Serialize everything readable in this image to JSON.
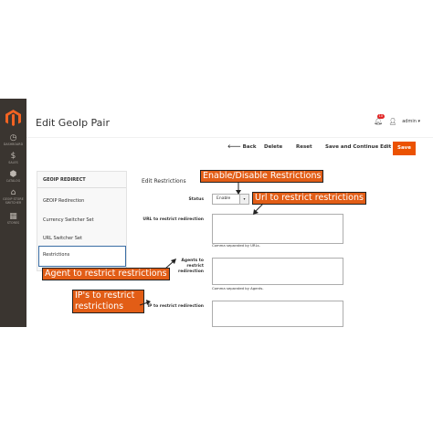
{
  "sidebar": {
    "items": [
      {
        "icon": "dashboard-icon",
        "glyph": "◷",
        "label": "DASHBOARD"
      },
      {
        "icon": "dollar-icon",
        "glyph": "$",
        "label": "SALES"
      },
      {
        "icon": "box-icon",
        "glyph": "⬢",
        "label": "CATALOG"
      },
      {
        "icon": "store-icon",
        "glyph": "⌂",
        "label": "GEOIP STORE SWITCHER"
      },
      {
        "icon": "stores-icon",
        "glyph": "▦",
        "label": "STORES"
      }
    ]
  },
  "header": {
    "title": "Edit GeoIp Pair",
    "notifications_count": "10",
    "user": "admin"
  },
  "actions": {
    "back": "Back",
    "delete": "Delete",
    "reset": "Reset",
    "save_continue": "Save and Continue Edit",
    "save": "Save"
  },
  "tabs": {
    "title": "GEOIP REDIRECT",
    "items": [
      "GEOIP Redirection",
      "Currency Switcher Set",
      "URL Switcher Set"
    ],
    "active": "Restrictions"
  },
  "form": {
    "section_title": "Edit Restrictions",
    "status_label": "Status",
    "status_value": "Enable",
    "url_label": "URL to restrict redirection",
    "url_note": "Comma separated by URLs.",
    "agents_label": "Agents to restrict redirection",
    "agents_note": "Comma separated by Agents.",
    "ip_label": "IP to restrict redirection"
  },
  "annotations": {
    "enable_disable": "Enable/Disable Restrictions",
    "url": "Url to restrict restrictions",
    "agent": "Agent to restrict restrictions",
    "ip_line1": "IP's to restrict",
    "ip_line2": "restrictions"
  },
  "colors": {
    "sidebar_bg": "#3a3530",
    "accent": "#eb5202",
    "annotation": "#e25d16"
  }
}
